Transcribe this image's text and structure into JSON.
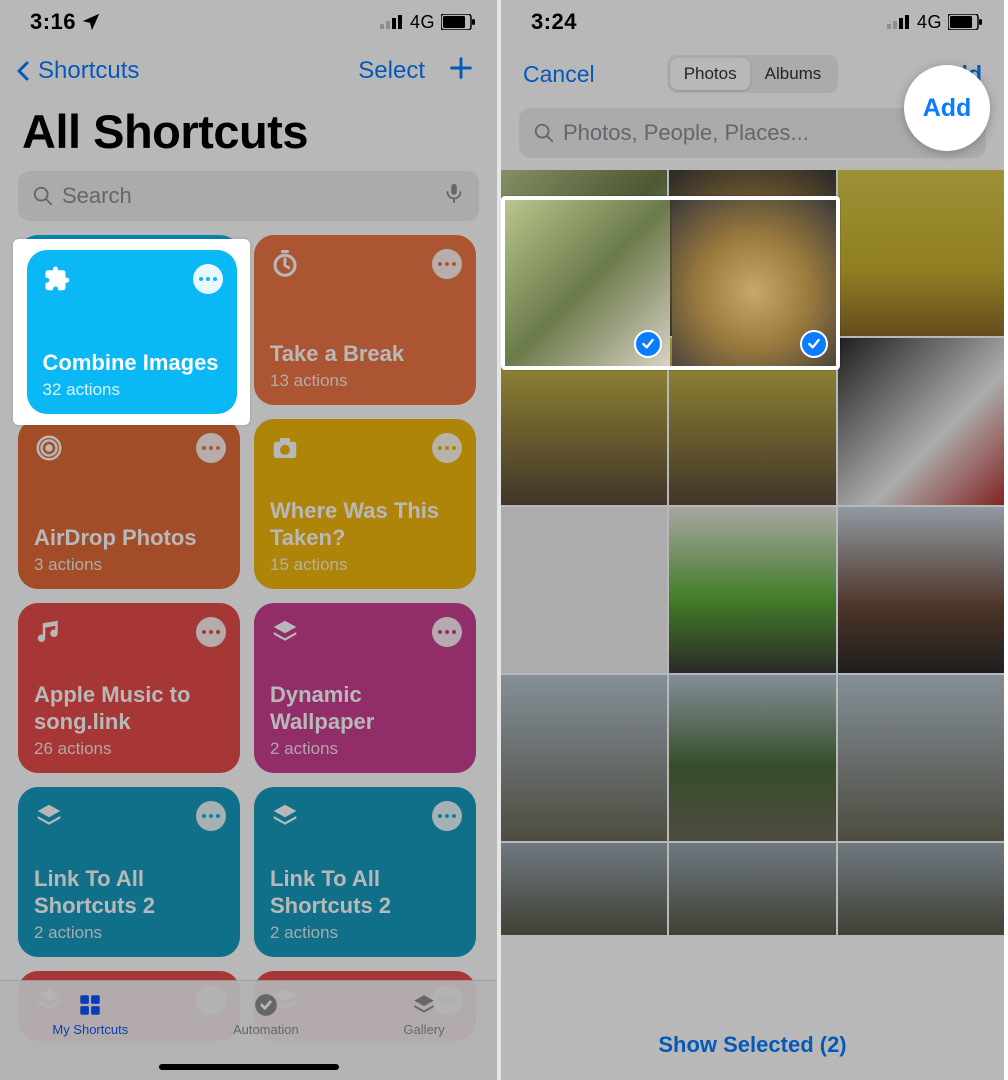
{
  "left": {
    "status": {
      "time": "3:16",
      "network": "4G"
    },
    "nav": {
      "back_label": "Shortcuts",
      "select_label": "Select"
    },
    "title": "All Shortcuts",
    "search_placeholder": "Search",
    "cards": [
      {
        "title": "Combine Images",
        "sub": "32 actions"
      },
      {
        "title": "Take a Break",
        "sub": "13 actions"
      },
      {
        "title": "AirDrop Photos",
        "sub": "3 actions"
      },
      {
        "title": "Where Was This Taken?",
        "sub": "15 actions"
      },
      {
        "title": "Apple Music to song.link",
        "sub": "26 actions"
      },
      {
        "title": "Dynamic Wallpaper",
        "sub": "2 actions"
      },
      {
        "title": "Link To All Shortcuts 2",
        "sub": "2 actions"
      },
      {
        "title": "Link To All Shortcuts 2",
        "sub": "2 actions"
      }
    ],
    "tabs": {
      "my": "My Shortcuts",
      "automation": "Automation",
      "gallery": "Gallery"
    }
  },
  "right": {
    "status": {
      "time": "3:24",
      "network": "4G"
    },
    "nav": {
      "cancel": "Cancel",
      "add": "Add",
      "seg_photos": "Photos",
      "seg_albums": "Albums"
    },
    "search_placeholder": "Photos, People, Places...",
    "selected_count": 2,
    "show_selected_label": "Show Selected (2)"
  }
}
